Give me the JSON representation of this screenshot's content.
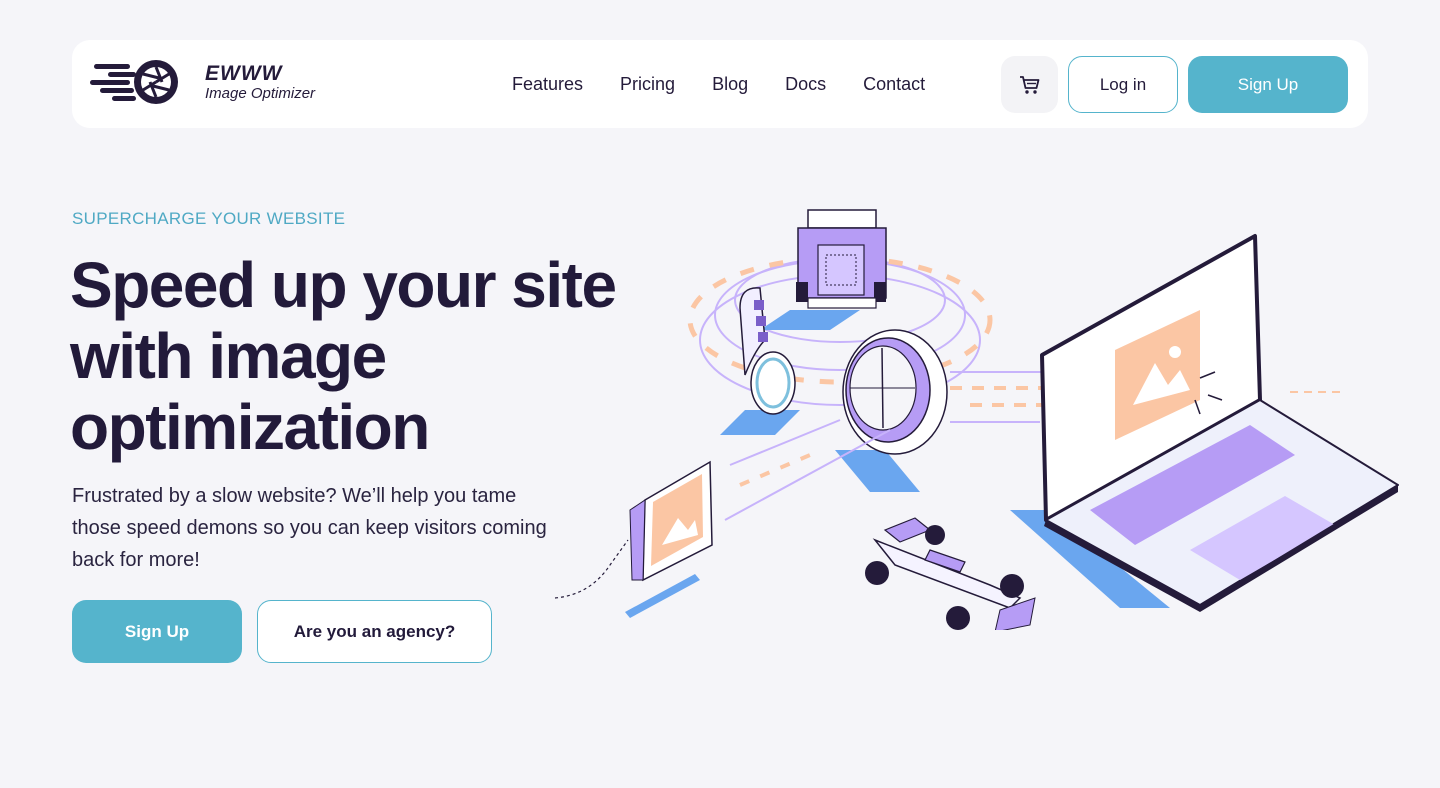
{
  "brand": {
    "name": "EWWW",
    "tagline": "Image Optimizer"
  },
  "nav": {
    "links": [
      "Features",
      "Pricing",
      "Blog",
      "Docs",
      "Contact"
    ],
    "cart_icon": "cart-icon",
    "login_label": "Log in",
    "signup_label": "Sign Up"
  },
  "hero": {
    "eyebrow": "SUPERCHARGE YOUR WEBSITE",
    "headline": "Speed up your site with image optimization",
    "subtext": "Frustrated by a slow website? We’ll help you tame those speed demons so you can keep visitors coming back for more!",
    "primary_cta": "Sign Up",
    "secondary_cta": "Are you an agency?"
  },
  "colors": {
    "accent": "#55b4cc",
    "text_dark": "#221a3a",
    "background": "#f5f5f9",
    "illustration_purple": "#b69cf5",
    "illustration_peach": "#fbc6a4",
    "illustration_blue": "#6aa6ef"
  }
}
